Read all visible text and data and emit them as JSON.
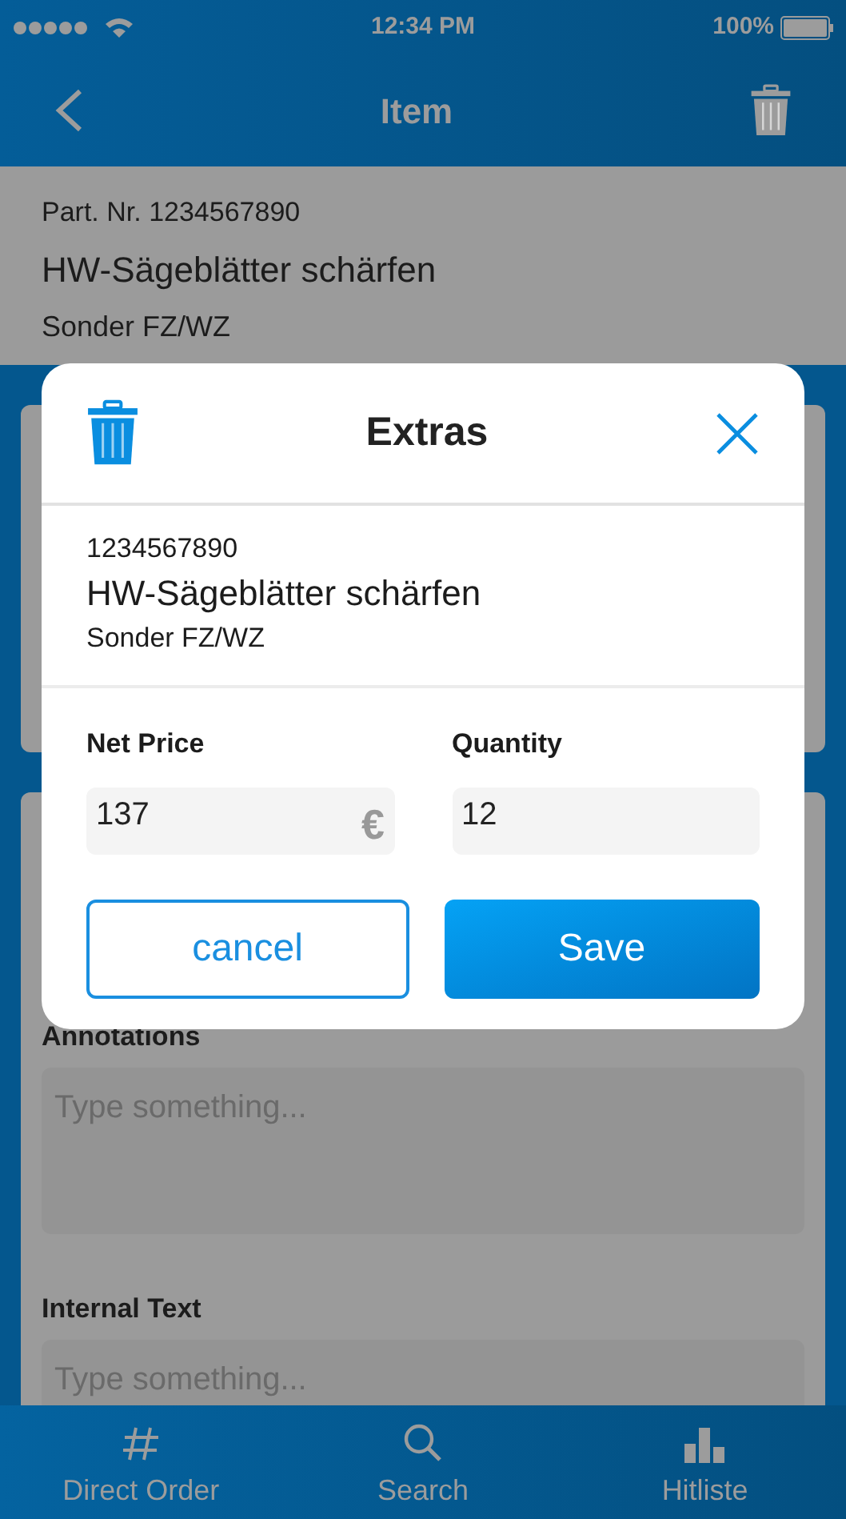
{
  "status_bar": {
    "time": "12:34 PM",
    "battery": "100%"
  },
  "nav": {
    "title": "Item"
  },
  "item": {
    "part_number": "Part. Nr. 1234567890",
    "name": "HW-Sägeblätter schärfen",
    "category": "Sonder FZ/WZ"
  },
  "sections": [
    {
      "label": "Annotations",
      "placeholder": "Type something..."
    },
    {
      "label": "Internal Text",
      "placeholder": "Type something..."
    }
  ],
  "dialog": {
    "title": "Extras",
    "item": {
      "number": "1234567890",
      "name": "HW-Sägeblätter schärfen",
      "category": "Sonder FZ/WZ"
    },
    "fields": [
      {
        "label": "Net Price",
        "value": "137",
        "unit": "€"
      },
      {
        "label": "Quantity",
        "value": "12"
      }
    ],
    "buttons": [
      {
        "label": "cancel",
        "kind": "secondary"
      },
      {
        "label": "Save",
        "kind": "primary"
      }
    ]
  },
  "tabs": [
    {
      "label": "Direct Order"
    },
    {
      "label": "Search"
    },
    {
      "label": "Hitliste"
    }
  ]
}
